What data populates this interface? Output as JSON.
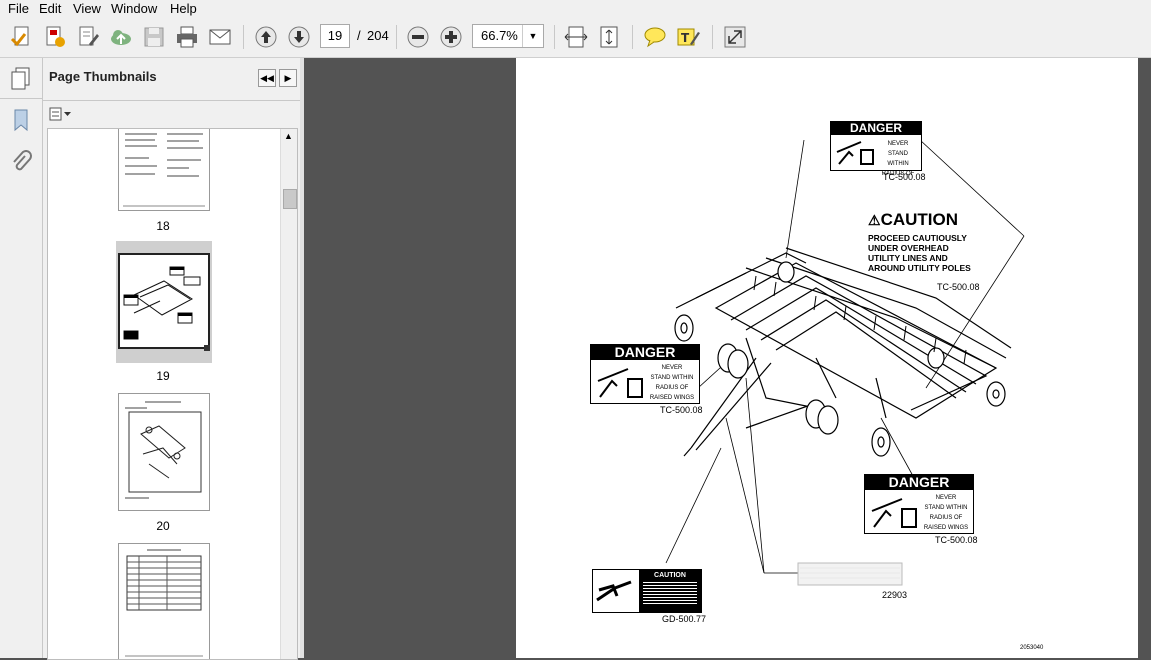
{
  "menu": [
    "File",
    "Edit",
    "View",
    "Window",
    "Help"
  ],
  "toolbar": {
    "current_page": "19",
    "page_separator": "/",
    "total_pages": "204",
    "zoom": "66.7%",
    "icons": [
      "create-pdf-icon",
      "export-pdf-icon",
      "edit-pdf-icon",
      "upload-cloud-icon",
      "save-icon",
      "print-icon",
      "email-icon",
      "page-up-icon",
      "page-down-icon",
      "zoom-out-icon",
      "zoom-in-icon",
      "fit-width-icon",
      "fit-page-icon",
      "comment-icon",
      "highlight-icon",
      "fullscreen-icon"
    ]
  },
  "panel": {
    "title": "Page Thumbnails",
    "thumbnails": [
      {
        "label": "18"
      },
      {
        "label": "19"
      },
      {
        "label": "20"
      },
      {
        "label": ""
      }
    ]
  },
  "page": {
    "labels": {
      "tc1": "TC-500.08",
      "tc2": "TC-500.08",
      "tc3": "TC-500.08",
      "tc4": "TC-500.08",
      "gd": "GD-500.77",
      "part": "22903",
      "figure_no": "2053040"
    },
    "danger": {
      "header": "DANGER",
      "line1": "NEVER",
      "line2": "STAND WITHIN",
      "line3": "RADIUS OF",
      "line4": "RAISED WINGS"
    },
    "caution_big": {
      "header": "CAUTION",
      "line1": "PROCEED CAUTIOUSLY",
      "line2": "UNDER OVERHEAD",
      "line3": "UTILITY LINES AND",
      "line4": "AROUND UTILITY POLES"
    },
    "caution_small": {
      "header": "CAUTION"
    }
  }
}
